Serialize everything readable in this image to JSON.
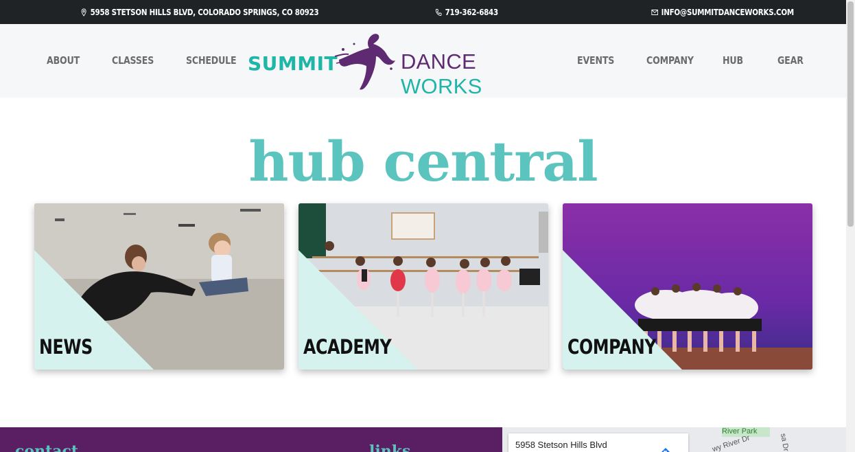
{
  "topbar": {
    "address": "5958 STETSON HILLS BLVD, COLORADO SPRINGS, CO 80923",
    "phone": "719-362-6843",
    "email": "INFO@SUMMITDANCEWORKS.COM",
    "address_icon": "map-pin-icon",
    "phone_icon": "phone-icon",
    "email_icon": "envelope-icon"
  },
  "nav": {
    "left": [
      "ABOUT",
      "CLASSES",
      "SCHEDULE"
    ],
    "right": [
      "EVENTS",
      "COMPANY",
      "HUB",
      "GEAR"
    ]
  },
  "logo": {
    "summit": "SUMMIT",
    "dance": "DANCE",
    "works": "WORKS",
    "teal": "#1fb5a7",
    "purple": "#5e2a72"
  },
  "heading": "hub central",
  "cards": [
    {
      "label": "NEWS"
    },
    {
      "label": "ACADEMY"
    },
    {
      "label": "COMPANY"
    }
  ],
  "footer": {
    "contact_title": "contact",
    "links_title": "links",
    "bg_color": "#5a1e63",
    "accent_color": "#5cc4bf"
  },
  "map": {
    "place": "5958 Stetson Hills Blvd",
    "park_label": "River Park",
    "road_label": "wy River Dr",
    "road_label_2": "sa Dr"
  }
}
